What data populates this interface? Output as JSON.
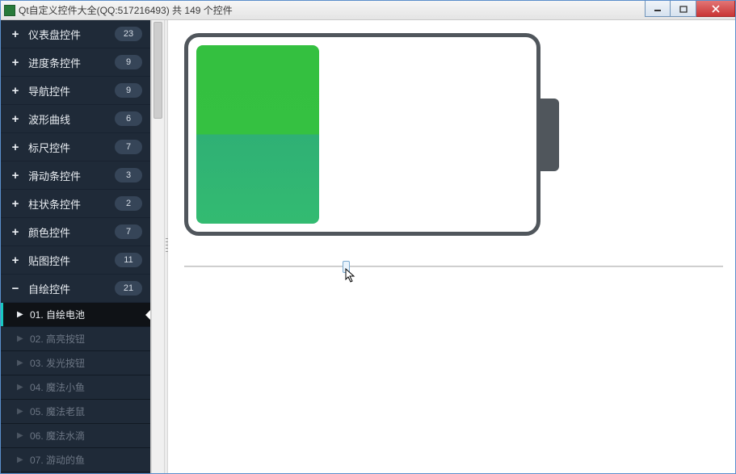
{
  "window": {
    "title": "Qt自定义控件大全(QQ:517216493) 共 149 个控件"
  },
  "sidebar": {
    "categories": [
      {
        "sign": "+",
        "label": "仪表盘控件",
        "count": "23"
      },
      {
        "sign": "+",
        "label": "进度条控件",
        "count": "9"
      },
      {
        "sign": "+",
        "label": "导航控件",
        "count": "9"
      },
      {
        "sign": "+",
        "label": "波形曲线",
        "count": "6"
      },
      {
        "sign": "+",
        "label": "标尺控件",
        "count": "7"
      },
      {
        "sign": "+",
        "label": "滑动条控件",
        "count": "3"
      },
      {
        "sign": "+",
        "label": "柱状条控件",
        "count": "2"
      },
      {
        "sign": "+",
        "label": "颜色控件",
        "count": "7"
      },
      {
        "sign": "+",
        "label": "贴图控件",
        "count": "11"
      },
      {
        "sign": "−",
        "label": "自绘控件",
        "count": "21"
      }
    ],
    "subitems": [
      {
        "label": "01. 自绘电池",
        "active": true
      },
      {
        "label": "02. 高亮按钮",
        "active": false
      },
      {
        "label": "03. 发光按钮",
        "active": false
      },
      {
        "label": "04. 魔法小鱼",
        "active": false
      },
      {
        "label": "05. 魔法老鼠",
        "active": false
      },
      {
        "label": "06. 魔法水滴",
        "active": false
      },
      {
        "label": "07. 游动的鱼",
        "active": false
      }
    ]
  },
  "battery": {
    "percent": 37
  },
  "slider": {
    "value": 30,
    "min": 0,
    "max": 100
  }
}
